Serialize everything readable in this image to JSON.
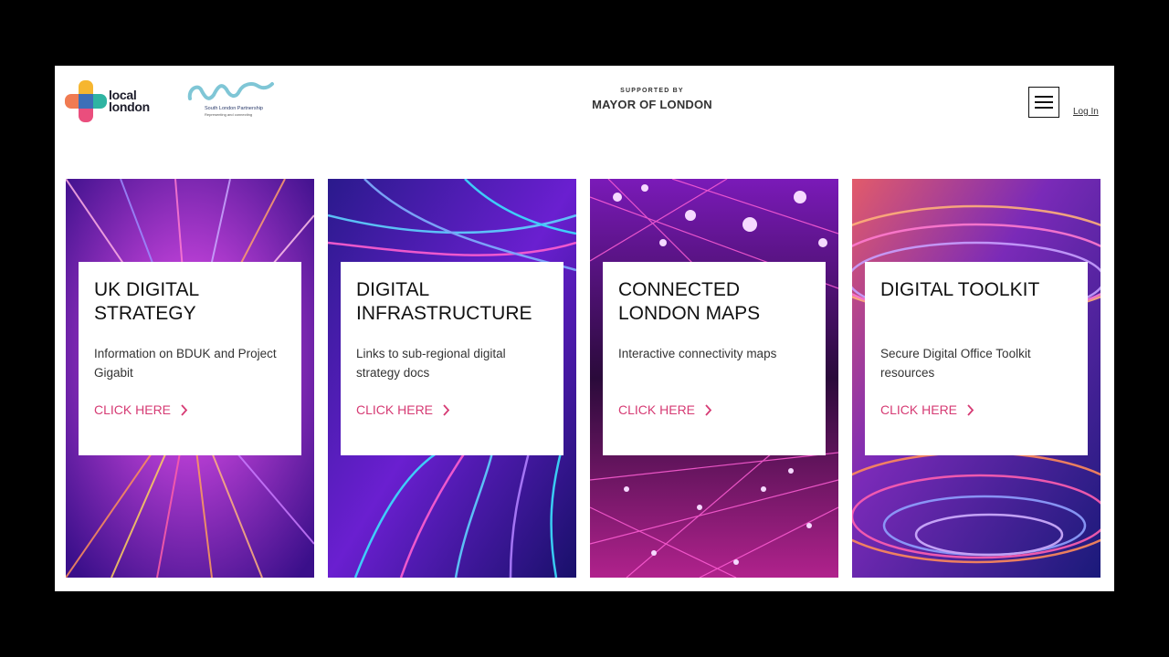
{
  "header": {
    "logo_local_word_1": "local",
    "logo_local_word_2": "london",
    "slp_name": "South London Partnership",
    "slp_tagline": "Representing and connecting",
    "supported_by": "SUPPORTED BY",
    "mayor": "MAYOR OF LONDON",
    "login_label": "Log In"
  },
  "cards": [
    {
      "title": "UK DIGITAL STRATEGY",
      "description": "Information on BDUK and Project Gigabit",
      "cta": "CLICK HERE"
    },
    {
      "title": "DIGITAL INFRASTRUCTURE",
      "description": "Links to sub-regional digital strategy docs",
      "cta": "CLICK HERE"
    },
    {
      "title": "CONNECTED LONDON MAPS",
      "description": "Interactive connectivity maps",
      "cta": "CLICK HERE"
    },
    {
      "title": "DIGITAL TOOLKIT",
      "description": "Secure Digital Office Toolkit resources",
      "cta": "CLICK HERE"
    }
  ],
  "colors": {
    "accent": "#d63b74",
    "page_bg": "#ffffff",
    "frame": "#000000"
  },
  "icons": {
    "menu": "hamburger-icon",
    "cta": "chevron-right-icon"
  }
}
